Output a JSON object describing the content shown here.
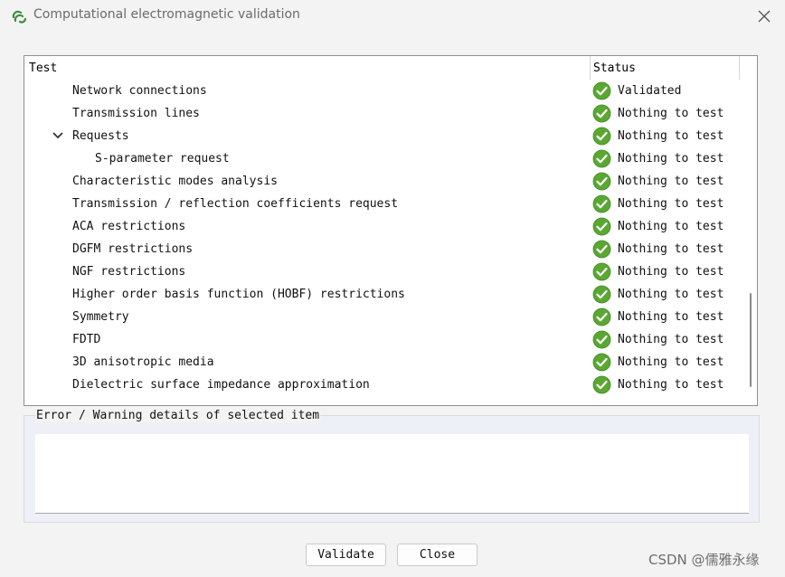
{
  "window": {
    "title": "Computational electromagnetic validation"
  },
  "tree": {
    "headers": {
      "test": "Test",
      "status": "Status"
    },
    "rows": [
      {
        "label": "Network connections",
        "status": "Validated",
        "level": 1
      },
      {
        "label": "Transmission lines",
        "status": "Nothing to test",
        "level": 1
      },
      {
        "label": "Requests",
        "status": "Nothing to test",
        "level": 1,
        "expanded": true
      },
      {
        "label": "S-parameter request",
        "status": "Nothing to test",
        "level": 2
      },
      {
        "label": "Characteristic modes analysis",
        "status": "Nothing to test",
        "level": 1
      },
      {
        "label": "Transmission / reflection coefficients request",
        "status": "Nothing to test",
        "level": 1
      },
      {
        "label": "ACA restrictions",
        "status": "Nothing to test",
        "level": 1
      },
      {
        "label": "DGFM restrictions",
        "status": "Nothing to test",
        "level": 1
      },
      {
        "label": "NGF restrictions",
        "status": "Nothing to test",
        "level": 1
      },
      {
        "label": "Higher order basis function (HOBF) restrictions",
        "status": "Nothing to test",
        "level": 1
      },
      {
        "label": "Symmetry",
        "status": "Nothing to test",
        "level": 1
      },
      {
        "label": "FDTD",
        "status": "Nothing to test",
        "level": 1
      },
      {
        "label": "3D anisotropic media",
        "status": "Nothing to test",
        "level": 1
      },
      {
        "label": "Dielectric surface impedance approximation",
        "status": "Nothing to test",
        "level": 1
      }
    ]
  },
  "details": {
    "legend": "Error / Warning details of selected item",
    "text": ""
  },
  "buttons": {
    "validate": "Validate",
    "close": "Close"
  },
  "watermark": "CSDN @儒雅永缘",
  "icons": {
    "app": "cem-app-icon",
    "close": "close-icon",
    "status": "check-circle-icon",
    "expand": "chevron-down-icon"
  },
  "colors": {
    "status_green": "#5aa832",
    "app_icon_green": "#3a8f3a"
  }
}
